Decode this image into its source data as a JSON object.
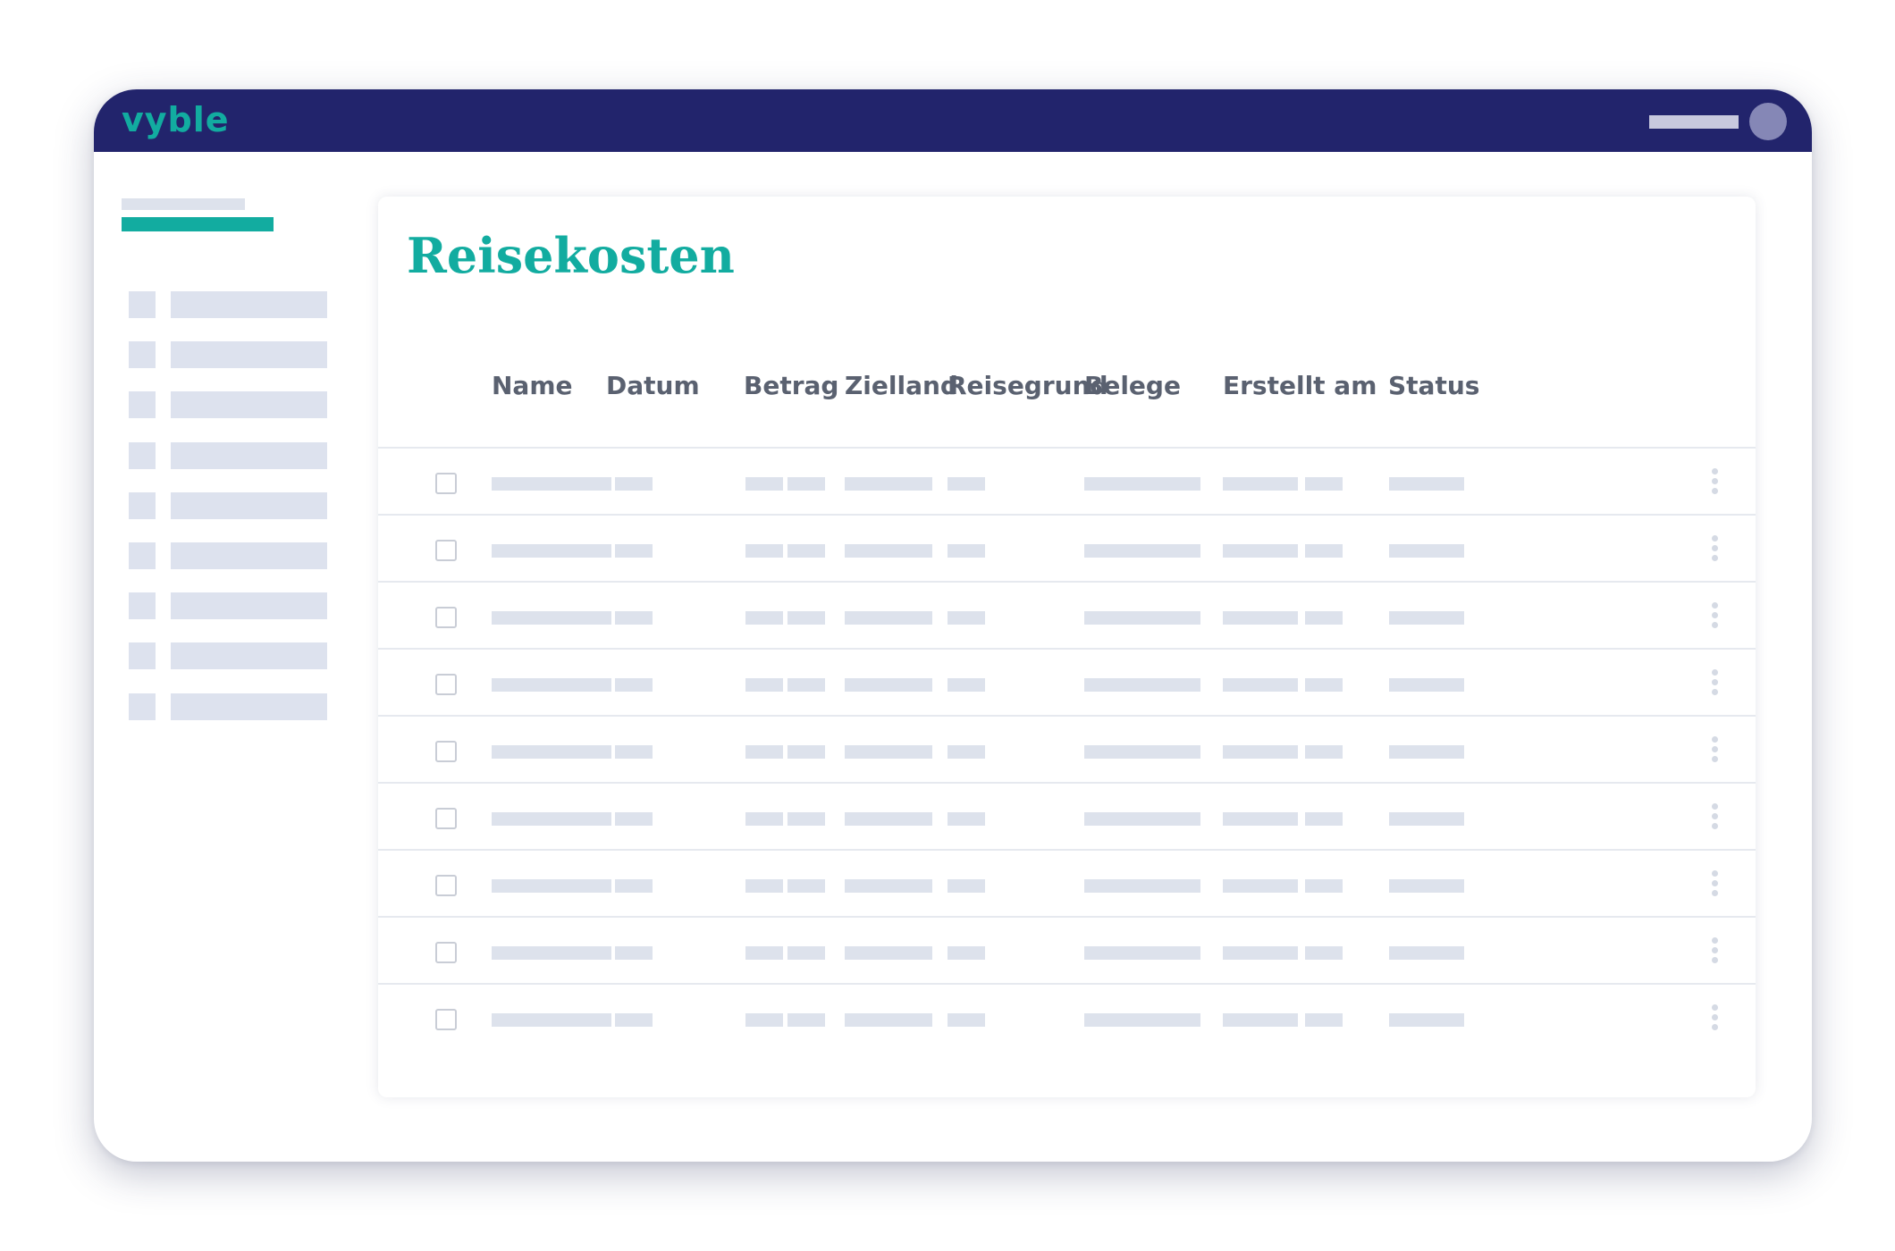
{
  "app": {
    "logo": "vyble"
  },
  "page": {
    "title": "Reisekosten"
  },
  "table": {
    "columns": [
      "Name",
      "Datum",
      "Betrag",
      "Zielland",
      "Reisegrund",
      "Belege",
      "Erstellt am",
      "Status"
    ],
    "row_count": 9
  },
  "sidebar": {
    "item_count": 9
  },
  "colors": {
    "topbar": "#22246c",
    "accent": "#12aca0",
    "placeholder": "#dde2ec",
    "header_text": "#5a6170"
  }
}
